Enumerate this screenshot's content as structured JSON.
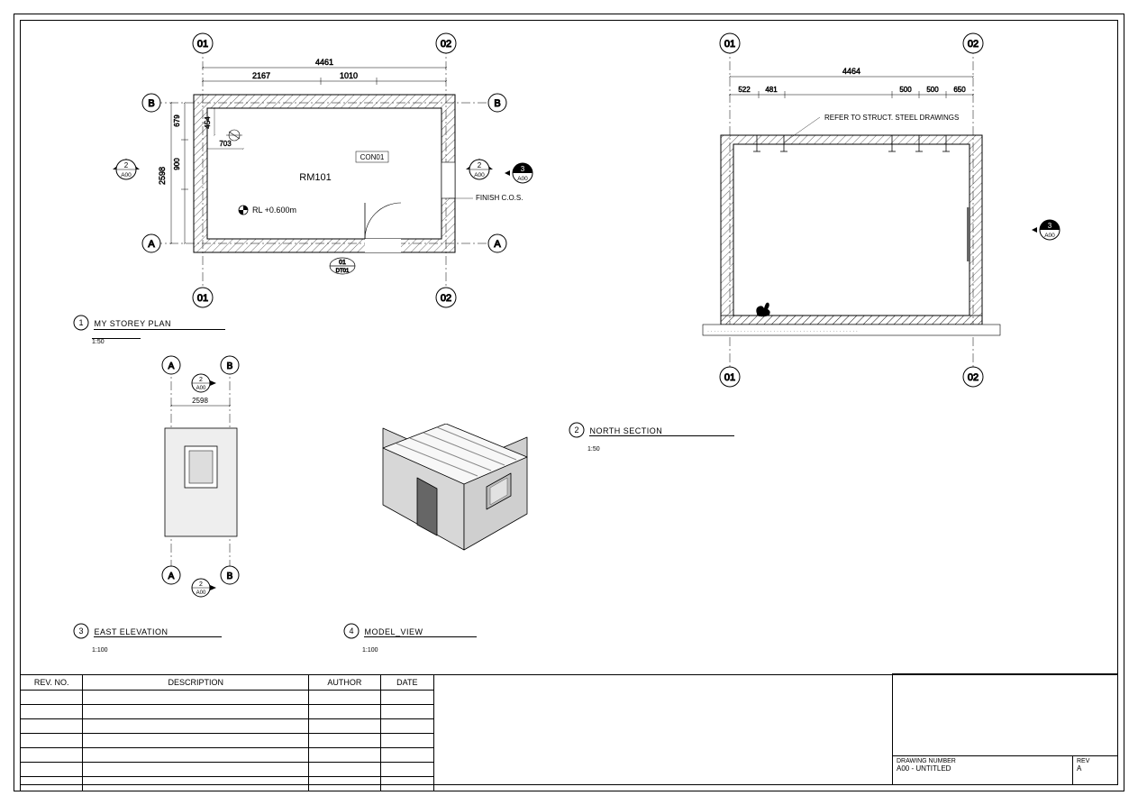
{
  "grids": {
    "g01": "01",
    "g02": "02",
    "gA": "A",
    "gB": "B"
  },
  "plan": {
    "room": "RM101",
    "rl": "RL +0.600m",
    "tag_con": "CON01",
    "finish": "FINISH C.O.S.",
    "dim_overall_w": "4461",
    "dim_seg1": "2167",
    "dim_seg2": "1010",
    "dim_2598": "2598",
    "dim_679": "679",
    "dim_900": "900",
    "dim_703": "703",
    "dim_454": "454",
    "detail_ref_top": "01",
    "detail_ref_bot": "DT01",
    "sec_ref": "2",
    "sec_sheet": "A00",
    "view_ref": "3",
    "view_sheet": "A00"
  },
  "section": {
    "overall": "4464",
    "d1": "522",
    "d2": "481",
    "d3": "500",
    "d4": "500",
    "d5": "650",
    "note": "REFER TO STRUCT. STEEL DRAWINGS",
    "view_ref": "3",
    "view_sheet": "A00"
  },
  "elev": {
    "dim": "2598",
    "sec_ref": "2",
    "sec_sheet": "A00"
  },
  "views": {
    "v1_num": "1",
    "v1_title": "MY STOREY PLAN",
    "v1_scale": "1:50",
    "v2_num": "2",
    "v2_title": "NORTH SECTION",
    "v2_scale": "1:50",
    "v3_num": "3",
    "v3_title": "EAST ELEVATION",
    "v3_scale": "1:100",
    "v4_num": "4",
    "v4_title": "MODEL_VIEW",
    "v4_scale": "1:100"
  },
  "rev_table": {
    "h1": "REV. NO.",
    "h2": "DESCRIPTION",
    "h3": "AUTHOR",
    "h4": "DATE"
  },
  "title_block": {
    "dn_label": "DRAWING NUMBER",
    "dn": "A00 - UNTITLED",
    "rev_label": "REV",
    "rev": "A"
  }
}
